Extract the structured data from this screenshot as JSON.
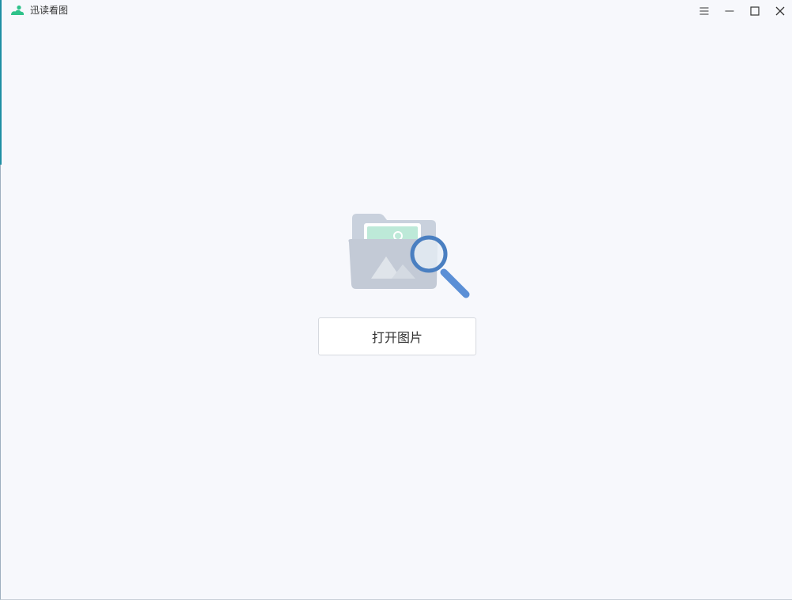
{
  "app": {
    "title": "迅读看图"
  },
  "window_controls": {
    "menu_icon": "hamburger-menu-icon",
    "minimize_icon": "minimize-icon",
    "maximize_icon": "maximize-icon",
    "close_icon": "close-icon"
  },
  "main": {
    "illustration_icon": "folder-image-search-icon",
    "open_button_label": "打开图片"
  },
  "colors": {
    "background": "#f7f8fc",
    "logo_green": "#2fc28a",
    "folder_gray": "#c3c9d4",
    "magnifier_blue": "#4a7fc1"
  }
}
